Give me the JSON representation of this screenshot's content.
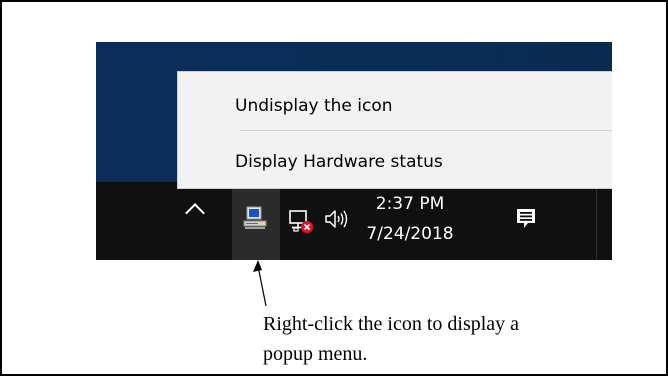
{
  "context_menu": {
    "items": [
      {
        "label": "Undisplay the icon"
      },
      {
        "label": "Display Hardware status"
      }
    ]
  },
  "taskbar": {
    "tray_icons": [
      "chevron-up-icon",
      "hardware-status-icon",
      "network-error-icon",
      "volume-icon"
    ],
    "clock": {
      "time": "2:37 PM",
      "date": "7/24/2018"
    },
    "notification_icon": "action-center-icon"
  },
  "caption": {
    "line1": "Right-click the icon to display a",
    "line2": "popup menu."
  },
  "colors": {
    "desktop": "#0a2d58",
    "taskbar": "#101010",
    "menu_bg": "#f2f2f2",
    "error_badge": "#e81123"
  }
}
